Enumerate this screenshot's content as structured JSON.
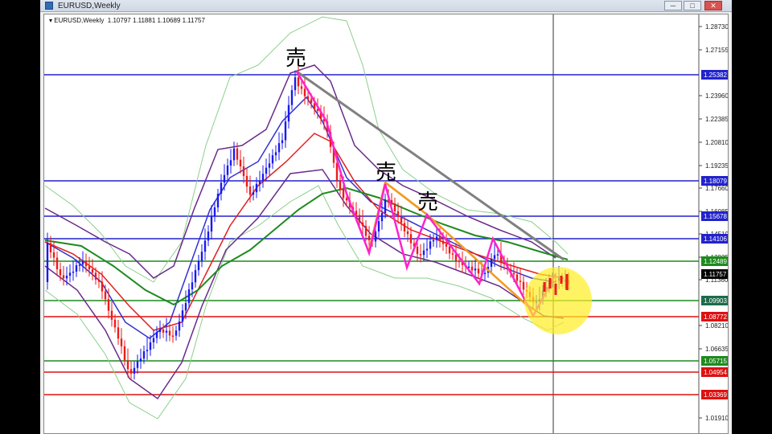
{
  "window": {
    "title": "EURUSD,Weekly",
    "minimize": "─",
    "maximize": "□",
    "close": "✕"
  },
  "chart": {
    "symbol": "EURUSD,Weekly",
    "ohlc": "1.10797 1.11881 1.10689 1.11757",
    "axis_labels": [
      "1.28730",
      "1.27155",
      "1.23960",
      "1.22385",
      "1.20810",
      "1.19235",
      "1.17660",
      "1.16085",
      "1.14510",
      "1.12935",
      "1.11360",
      "1.08210",
      "1.06635",
      "1.01910"
    ],
    "price_tags": [
      {
        "label": "1.25382",
        "color": "#2222cc"
      },
      {
        "label": "1.18079",
        "color": "#2222cc"
      },
      {
        "label": "1.15678",
        "color": "#2222cc"
      },
      {
        "label": "1.14106",
        "color": "#2222cc"
      },
      {
        "label": "1.12489",
        "color": "#1e8a1e"
      },
      {
        "label": "1.11757",
        "color": "#000000"
      },
      {
        "label": "1.09903",
        "color": "#1e6b4a"
      },
      {
        "label": "1.08772",
        "color": "#dd1111"
      },
      {
        "label": "1.05715",
        "color": "#1e8a1e"
      },
      {
        "label": "1.04954",
        "color": "#dd1111"
      },
      {
        "label": "1.03369",
        "color": "#dd1111"
      }
    ],
    "annotations": [
      "売",
      "売",
      "売"
    ],
    "colors": {
      "blue_level": "#2222cc",
      "green_level": "#1e8a1e",
      "red_level": "#dd1111",
      "trendline": "#808080",
      "zigzag": "#ff22cc",
      "orange_line": "#f39a1e",
      "highlight": "#ffee22"
    }
  }
}
